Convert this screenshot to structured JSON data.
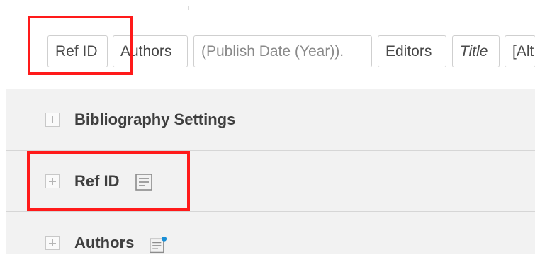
{
  "chips": [
    {
      "label": "Ref ID"
    },
    {
      "label": "Authors"
    },
    {
      "label": "(Publish Date (Year))."
    },
    {
      "label": "Editors"
    },
    {
      "label": "Title"
    },
    {
      "label": "[Alt"
    }
  ],
  "settings": {
    "rows": [
      {
        "label": "Bibliography Settings"
      },
      {
        "label": "Ref ID"
      },
      {
        "label": "Authors"
      }
    ]
  },
  "colors": {
    "highlight": "#ff1a1a",
    "indicator_dot": "#1a8fd6"
  },
  "icons": {
    "expand": "plus-box-icon",
    "notes": "notes-icon"
  }
}
